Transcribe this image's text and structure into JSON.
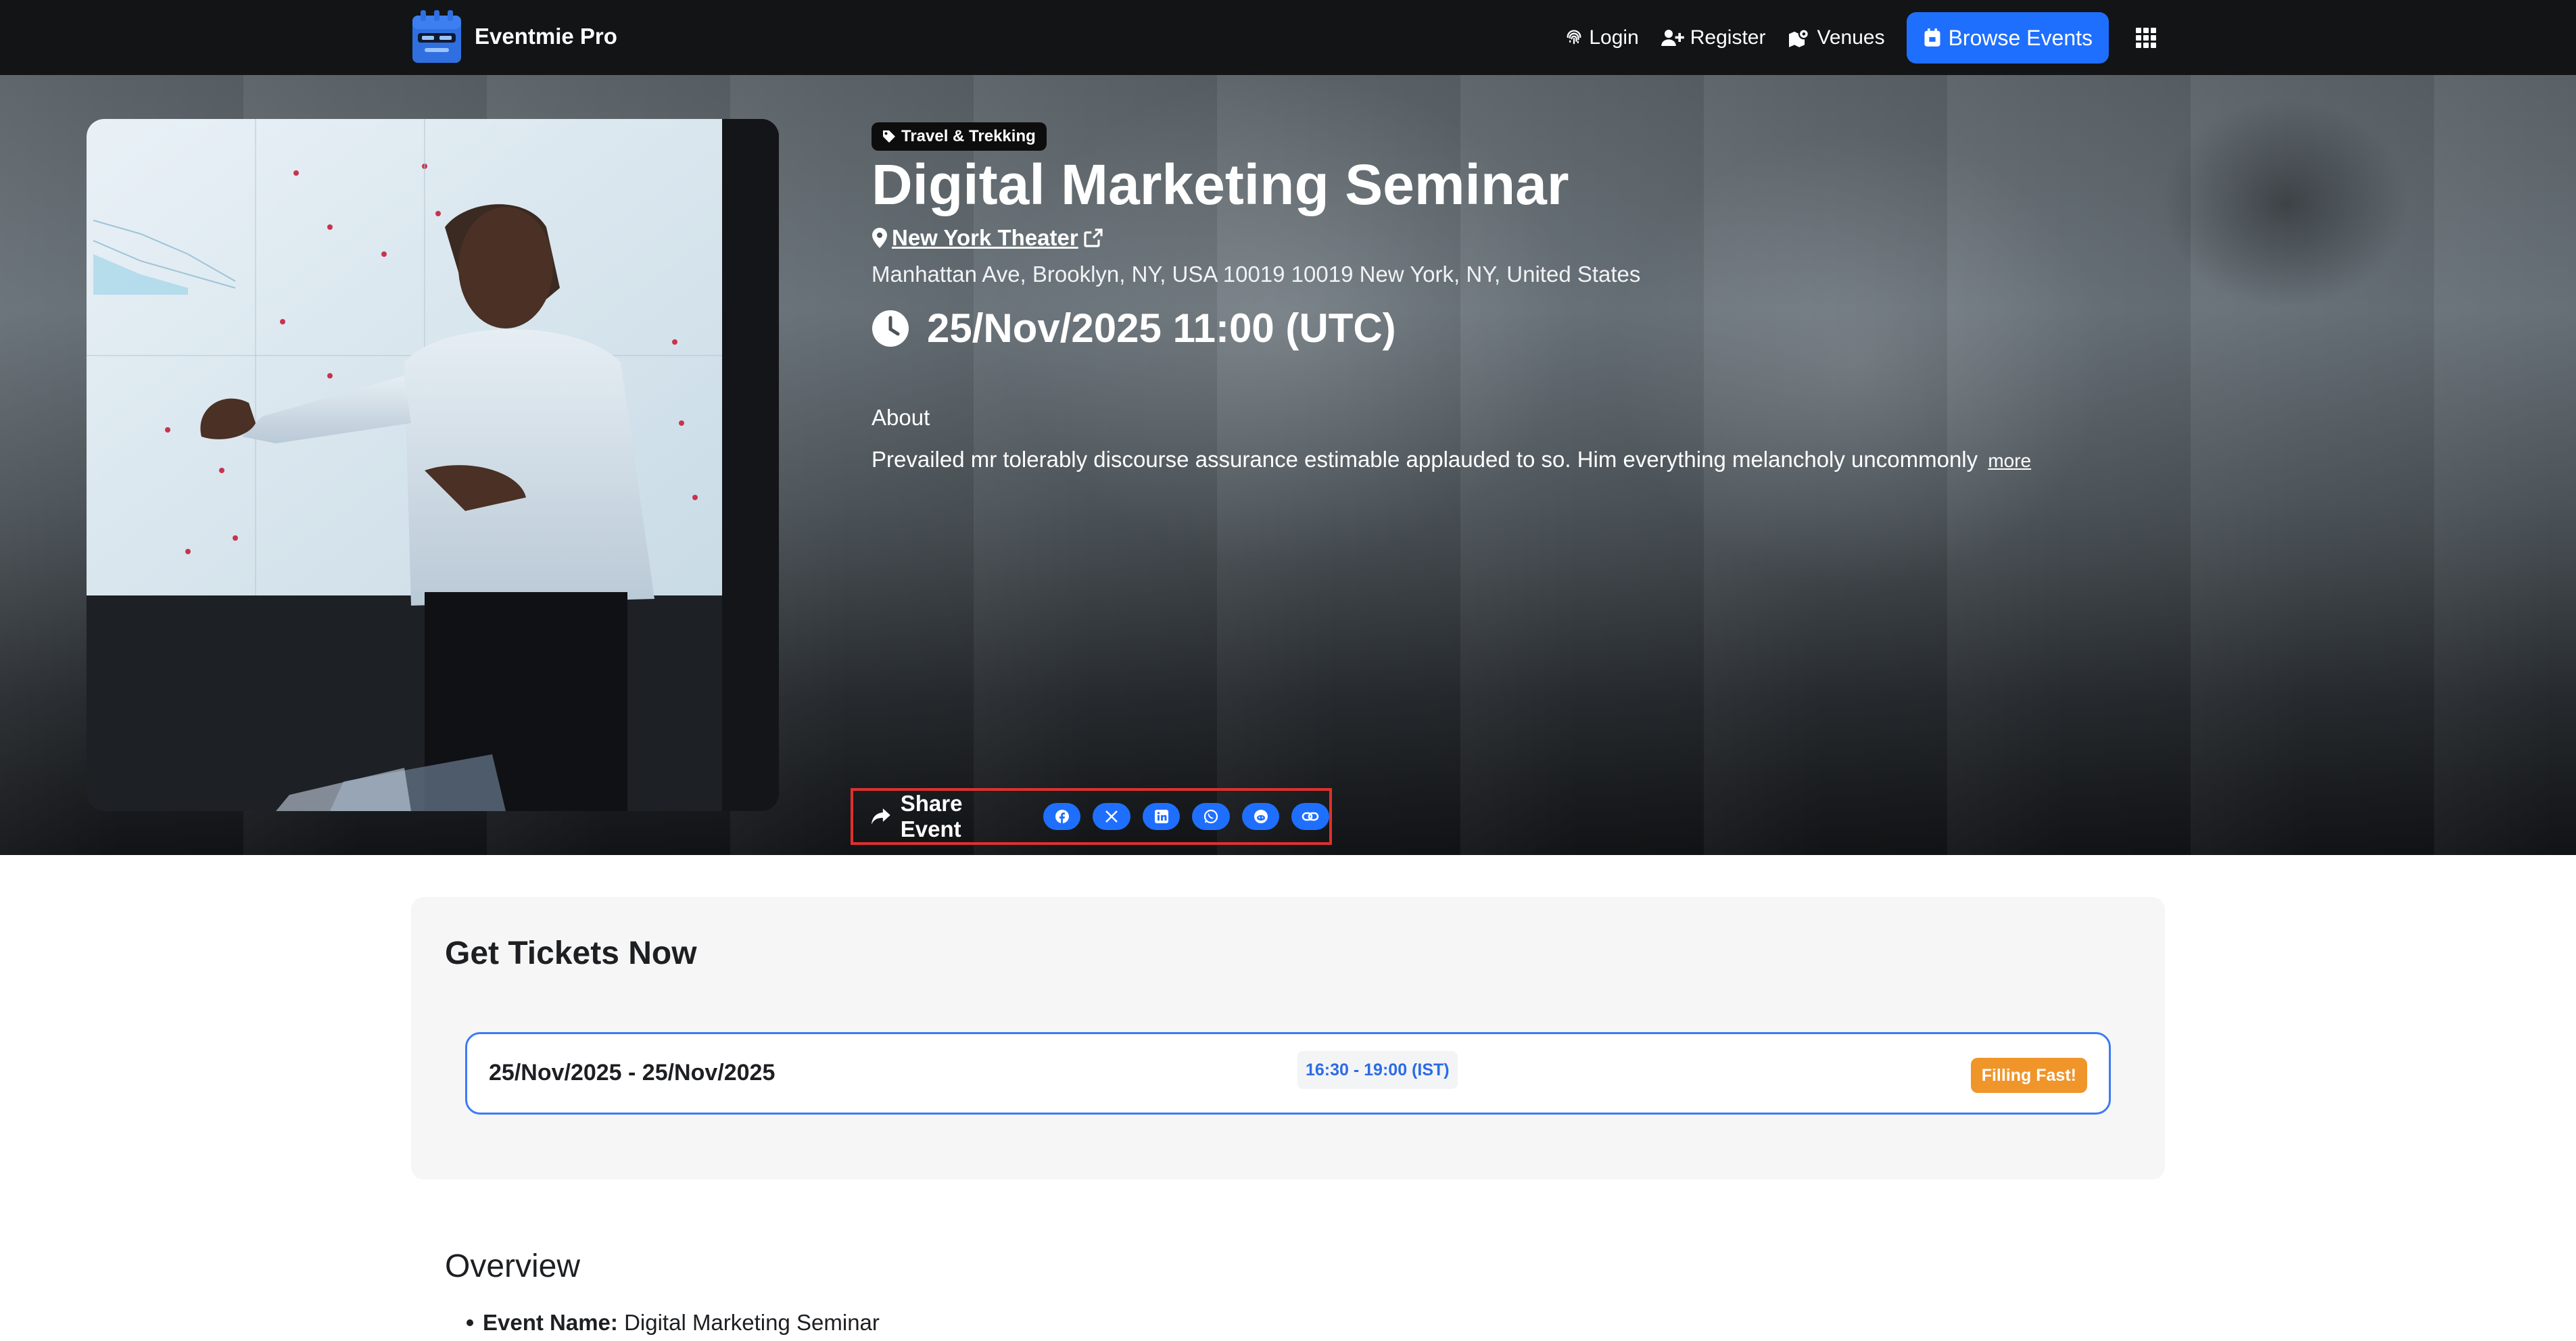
{
  "navbar": {
    "brand": "Eventmie Pro",
    "login": "Login",
    "register": "Register",
    "venues": "Venues",
    "browse_events": "Browse Events"
  },
  "event": {
    "category": "Travel & Trekking",
    "title": "Digital Marketing Seminar",
    "venue": " New York Theater",
    "address": "Manhattan Ave, Brooklyn, NY, USA 10019 10019 New York, NY, United States",
    "datetime": "25/Nov/2025 11:00 (UTC)",
    "about_title": "About",
    "about_text": "Prevailed mr tolerably discourse assurance estimable applauded to so. Him everything melancholy uncommonly",
    "about_more": "more"
  },
  "share": {
    "label": "Share Event",
    "icons": [
      "facebook-icon",
      "x-icon",
      "linkedin-icon",
      "whatsapp-icon",
      "reddit-icon",
      "link-icon"
    ],
    "accent": "#1f6fff"
  },
  "tickets": {
    "title": "Get Tickets Now",
    "schedule": {
      "date_range": "25/Nov/2025 - 25/Nov/2025",
      "time": "16:30 - 19:00 (IST)",
      "badge": "Filling Fast!"
    }
  },
  "overview": {
    "title": "Overview",
    "items": [
      {
        "label": "Event Name:",
        "value": " Digital Marketing Seminar"
      }
    ]
  },
  "colors": {
    "navbar_bg": "#121416",
    "primary": "#1f6fff",
    "highlight_border": "#e0302e",
    "badge_warning": "#f0952a"
  }
}
